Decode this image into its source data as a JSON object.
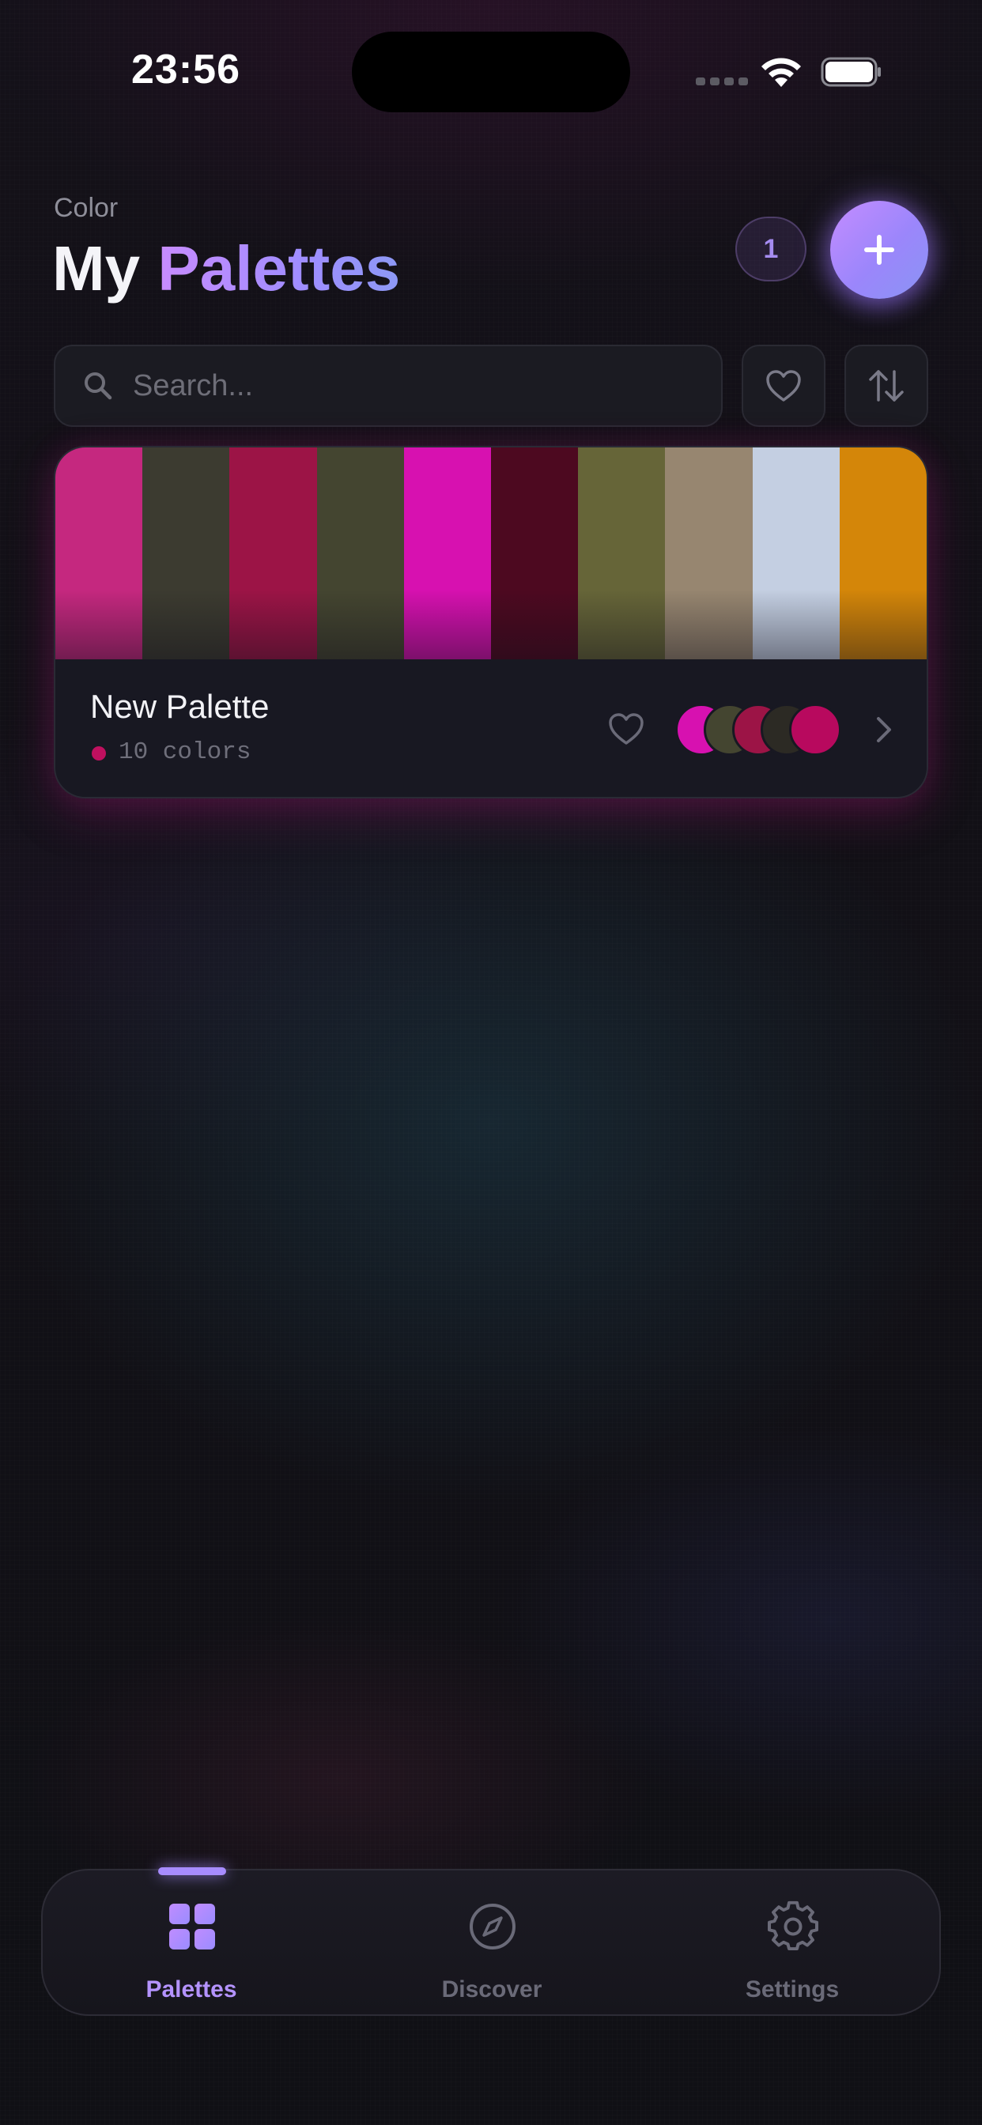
{
  "status_bar": {
    "time": "23:56",
    "icons": [
      "signal-icon",
      "wifi-icon",
      "battery-icon"
    ]
  },
  "header": {
    "eyebrow": "Color",
    "title_plain": "My",
    "title_accent": "Palettes",
    "palette_count": "1",
    "add_icon": "plus-icon"
  },
  "search": {
    "placeholder": "Search...",
    "value": "",
    "icon": "search-icon",
    "favorites_filter_icon": "heart-icon",
    "sort_icon": "sort-arrows-icon"
  },
  "palettes": [
    {
      "name": "New Palette",
      "colors_label": "10 colors",
      "favorite": false,
      "colors": [
        "#c5287f",
        "#3c3b30",
        "#9c1446",
        "#444530",
        "#d711b0",
        "#4d0920",
        "#666538",
        "#978670",
        "#c4cfe2",
        "#d48609"
      ],
      "preview_colors": [
        "#d711b0",
        "#444530",
        "#9c1446",
        "#2c2a24",
        "#b8095e"
      ],
      "dot_color": "#c0105f"
    }
  ],
  "tabbar": {
    "active": "palettes",
    "tabs": [
      {
        "id": "palettes",
        "label": "Palettes",
        "icon": "grid-icon"
      },
      {
        "id": "discover",
        "label": "Discover",
        "icon": "compass-icon"
      },
      {
        "id": "settings",
        "label": "Settings",
        "icon": "gear-icon"
      }
    ]
  },
  "colors": {
    "accent": "#a78cff",
    "accent_gradient_start": "#c48cff",
    "accent_gradient_end": "#8a94f4",
    "background": "#121016",
    "card": "#1a1a24"
  }
}
